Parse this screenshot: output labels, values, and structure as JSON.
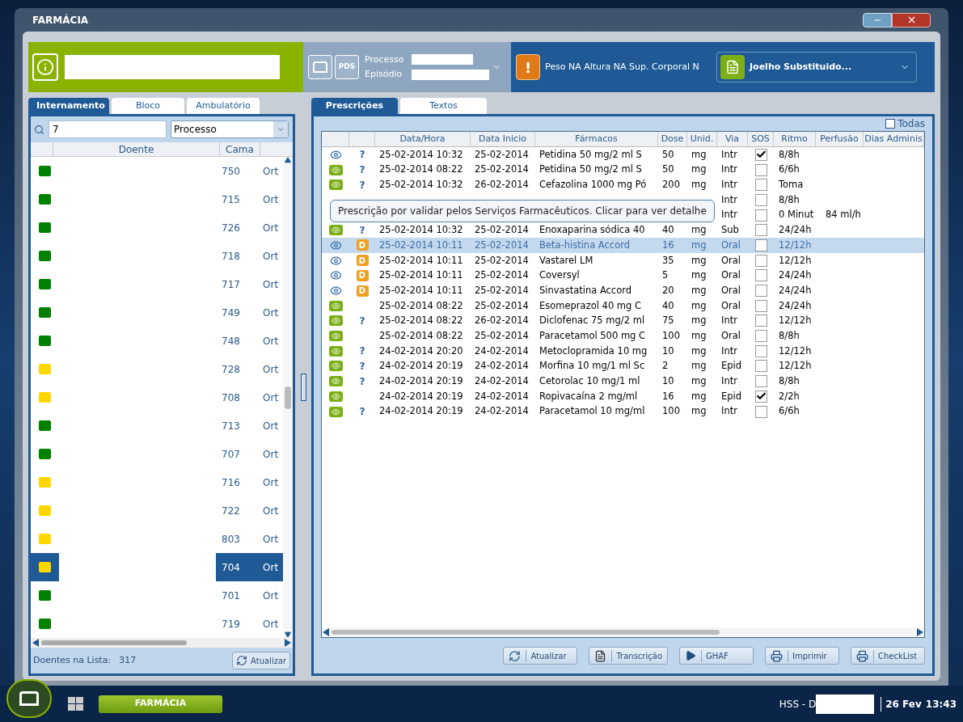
{
  "window": {
    "title": "FARMÁCIA"
  },
  "header": {
    "process_icons": [
      "PDS"
    ],
    "process_label": "Processo",
    "episode_label": "Episódio",
    "vitals": "Peso NA Altura NA Sup. Corporal N",
    "procedure": "Joelho Substituido...",
    "alert": "!"
  },
  "left_panel": {
    "tabs": [
      {
        "label": "Internamento",
        "selected": true
      },
      {
        "label": "Bloco",
        "selected": false
      },
      {
        "label": "Ambulatório",
        "selected": false
      }
    ],
    "search": {
      "value": "7",
      "filter": "Processo"
    },
    "columns": [
      "Doente",
      "Cama"
    ],
    "patients": [
      {
        "color": "#008000",
        "cama": "750",
        "service": "Ort",
        "selected": false
      },
      {
        "color": "#008000",
        "cama": "715",
        "service": "Ort",
        "selected": false
      },
      {
        "color": "#008000",
        "cama": "726",
        "service": "Ort",
        "selected": false
      },
      {
        "color": "#008000",
        "cama": "718",
        "service": "Ort",
        "selected": false
      },
      {
        "color": "#008000",
        "cama": "717",
        "service": "Ort",
        "selected": false
      },
      {
        "color": "#008000",
        "cama": "749",
        "service": "Ort",
        "selected": false
      },
      {
        "color": "#008000",
        "cama": "748",
        "service": "Ort",
        "selected": false
      },
      {
        "color": "#ffd700",
        "cama": "728",
        "service": "Ort",
        "selected": false
      },
      {
        "color": "#ffd700",
        "cama": "708",
        "service": "Ort",
        "selected": false
      },
      {
        "color": "#008000",
        "cama": "713",
        "service": "Ort",
        "selected": false
      },
      {
        "color": "#008000",
        "cama": "707",
        "service": "Ort",
        "selected": false
      },
      {
        "color": "#ffd700",
        "cama": "716",
        "service": "Ort",
        "selected": false
      },
      {
        "color": "#ffd700",
        "cama": "722",
        "service": "Ort",
        "selected": false
      },
      {
        "color": "#ffd700",
        "cama": "803",
        "service": "Ort",
        "selected": false
      },
      {
        "color": "#ffd700",
        "cama": "704",
        "service": "Ort",
        "selected": true
      },
      {
        "color": "#008000",
        "cama": "701",
        "service": "Ort",
        "selected": false
      },
      {
        "color": "#008000",
        "cama": "719",
        "service": "Ort",
        "selected": false
      }
    ],
    "footer_label": "Doentes na Lista:",
    "count": "317",
    "refresh_button": "Atualizar"
  },
  "right_panel": {
    "tabs": [
      {
        "label": "Prescrições",
        "selected": true
      },
      {
        "label": "Textos",
        "selected": false
      }
    ],
    "all_filter": {
      "label": "Todas",
      "checked": false
    },
    "columns": [
      "Data/Hora",
      "Data Inicio",
      "Fármacos",
      "Dose",
      "Unid.",
      "Via",
      "SOS",
      "Ritmo",
      "Perfusão",
      "Dias Adminis"
    ],
    "rows": [
      {
        "eye": {
          "kind": "plain"
        },
        "status": {
          "kind": "question",
          "text": "?"
        },
        "datetime": "25-02-2014 10:32",
        "start": "25-02-2014",
        "drug": "Petidina 50 mg/2 ml S",
        "dose": "50",
        "unit": "mg",
        "route": "Intr",
        "sos": true,
        "rhythm": "8/8h",
        "perfusion": "",
        "selected": false
      },
      {
        "eye": {
          "kind": "badge"
        },
        "status": {
          "kind": "question",
          "text": "?"
        },
        "datetime": "25-02-2014 08:22",
        "start": "25-02-2014",
        "drug": "Petidina 50 mg/2 ml S",
        "dose": "50",
        "unit": "mg",
        "route": "Intr",
        "sos": false,
        "rhythm": "6/6h",
        "perfusion": "",
        "selected": false
      },
      {
        "eye": {
          "kind": "badge"
        },
        "status": {
          "kind": "question",
          "text": "?"
        },
        "datetime": "25-02-2014 10:32",
        "start": "26-02-2014",
        "drug": "Cefazolina 1000 mg Pó",
        "dose": "200",
        "unit": "mg",
        "route": "Intr",
        "sos": false,
        "rhythm": "Toma",
        "perfusion": "",
        "selected": false
      },
      {
        "datetime": "",
        "start": "",
        "drug": "",
        "dose": "",
        "unit": "",
        "route": "Intr",
        "sos": false,
        "rhythm": "8/8h",
        "perfusion": "",
        "selected": false
      },
      {
        "datetime": "",
        "start": "",
        "drug": "",
        "dose": "",
        "unit": "",
        "route": "Intr",
        "sos": false,
        "rhythm": "0 Minut",
        "perfusion": "84 ml/h",
        "selected": false
      },
      {
        "eye": {
          "kind": "badge"
        },
        "status": {
          "kind": "question",
          "text": "?"
        },
        "datetime": "25-02-2014 10:32",
        "start": "25-02-2014",
        "drug": "Enoxaparina sódica 40",
        "dose": "40",
        "unit": "mg",
        "route": "Sub",
        "sos": false,
        "rhythm": "24/24h",
        "perfusion": "",
        "selected": false
      },
      {
        "eye": {
          "kind": "plain"
        },
        "status": {
          "kind": "badge",
          "text": "D"
        },
        "datetime": "25-02-2014 10:11",
        "start": "25-02-2014",
        "drug": "Beta-histina Accord",
        "dose": "16",
        "unit": "mg",
        "route": "Oral",
        "sos": false,
        "rhythm": "12/12h",
        "perfusion": "",
        "selected": true
      },
      {
        "eye": {
          "kind": "plain"
        },
        "status": {
          "kind": "badge",
          "text": "D"
        },
        "datetime": "25-02-2014 10:11",
        "start": "25-02-2014",
        "drug": "Vastarel LM",
        "dose": "35",
        "unit": "mg",
        "route": "Oral",
        "sos": false,
        "rhythm": "12/12h",
        "perfusion": "",
        "selected": false
      },
      {
        "eye": {
          "kind": "plain"
        },
        "status": {
          "kind": "badge",
          "text": "D"
        },
        "datetime": "25-02-2014 10:11",
        "start": "25-02-2014",
        "drug": "Coversyl",
        "dose": "5",
        "unit": "mg",
        "route": "Oral",
        "sos": false,
        "rhythm": "24/24h",
        "perfusion": "",
        "selected": false
      },
      {
        "eye": {
          "kind": "plain"
        },
        "status": {
          "kind": "badge",
          "text": "D"
        },
        "datetime": "25-02-2014 10:11",
        "start": "25-02-2014",
        "drug": "Sinvastatina Accord",
        "dose": "20",
        "unit": "mg",
        "route": "Oral",
        "sos": false,
        "rhythm": "24/24h",
        "perfusion": "",
        "selected": false
      },
      {
        "eye": {
          "kind": "badge"
        },
        "datetime": "25-02-2014 08:22",
        "start": "25-02-2014",
        "drug": "Esomeprazol 40 mg C",
        "dose": "40",
        "unit": "mg",
        "route": "Oral",
        "sos": false,
        "rhythm": "24/24h",
        "perfusion": "",
        "selected": false
      },
      {
        "eye": {
          "kind": "badge"
        },
        "status": {
          "kind": "question",
          "text": "?"
        },
        "datetime": "25-02-2014 08:22",
        "start": "26-02-2014",
        "drug": "Diclofenac 75 mg/2 ml",
        "dose": "75",
        "unit": "mg",
        "route": "Intr",
        "sos": false,
        "rhythm": "12/12h",
        "perfusion": "",
        "selected": false
      },
      {
        "eye": {
          "kind": "badge"
        },
        "datetime": "25-02-2014 08:22",
        "start": "25-02-2014",
        "drug": "Paracetamol 500 mg C",
        "dose": "100",
        "unit": "mg",
        "route": "Oral",
        "sos": false,
        "rhythm": "8/8h",
        "perfusion": "",
        "selected": false
      },
      {
        "eye": {
          "kind": "badge"
        },
        "status": {
          "kind": "question",
          "text": "?"
        },
        "datetime": "24-02-2014 20:20",
        "start": "24-02-2014",
        "drug": "Metoclopramida 10 mg",
        "dose": "10",
        "unit": "mg",
        "route": "Intr",
        "sos": false,
        "rhythm": "12/12h",
        "perfusion": "",
        "selected": false
      },
      {
        "eye": {
          "kind": "badge"
        },
        "status": {
          "kind": "question",
          "text": "?"
        },
        "datetime": "24-02-2014 20:19",
        "start": "24-02-2014",
        "drug": "Morfina 10 mg/1 ml Sc",
        "dose": "2",
        "unit": "mg",
        "route": "Epid",
        "sos": false,
        "rhythm": "12/12h",
        "perfusion": "",
        "selected": false
      },
      {
        "eye": {
          "kind": "badge"
        },
        "status": {
          "kind": "question",
          "text": "?"
        },
        "datetime": "24-02-2014 20:19",
        "start": "24-02-2014",
        "drug": "Cetorolac 10 mg/1 ml",
        "dose": "10",
        "unit": "mg",
        "route": "Intr",
        "sos": false,
        "rhythm": "8/8h",
        "perfusion": "",
        "selected": false
      },
      {
        "eye": {
          "kind": "badge"
        },
        "datetime": "24-02-2014 20:19",
        "start": "24-02-2014",
        "drug": "Ropivacaína 2 mg/ml",
        "dose": "16",
        "unit": "mg",
        "route": "Epid",
        "sos": true,
        "rhythm": "2/2h",
        "perfusion": "",
        "selected": false
      },
      {
        "eye": {
          "kind": "badge"
        },
        "status": {
          "kind": "question",
          "text": "?"
        },
        "datetime": "24-02-2014 20:19",
        "start": "24-02-2014",
        "drug": "Paracetamol 10 mg/ml",
        "dose": "100",
        "unit": "mg",
        "route": "Intr",
        "sos": false,
        "rhythm": "6/6h",
        "perfusion": "",
        "selected": false
      }
    ],
    "tooltip": "Prescrição por validar pelos Serviços Farmacêuticos. Clicar para ver detalhe",
    "buttons": [
      {
        "kind": "refresh",
        "label": "Atualizar"
      },
      {
        "kind": "transcribe",
        "label": "Transcrição"
      },
      {
        "kind": "play",
        "label": "GHAF"
      },
      {
        "kind": "print",
        "label": "Imprimir"
      },
      {
        "kind": "print",
        "label": "CheckList"
      }
    ]
  },
  "taskbar": {
    "app": "FARMÁCIA",
    "user_prefix": "HSS - D",
    "date": "26 Fev",
    "time": "13:43"
  }
}
